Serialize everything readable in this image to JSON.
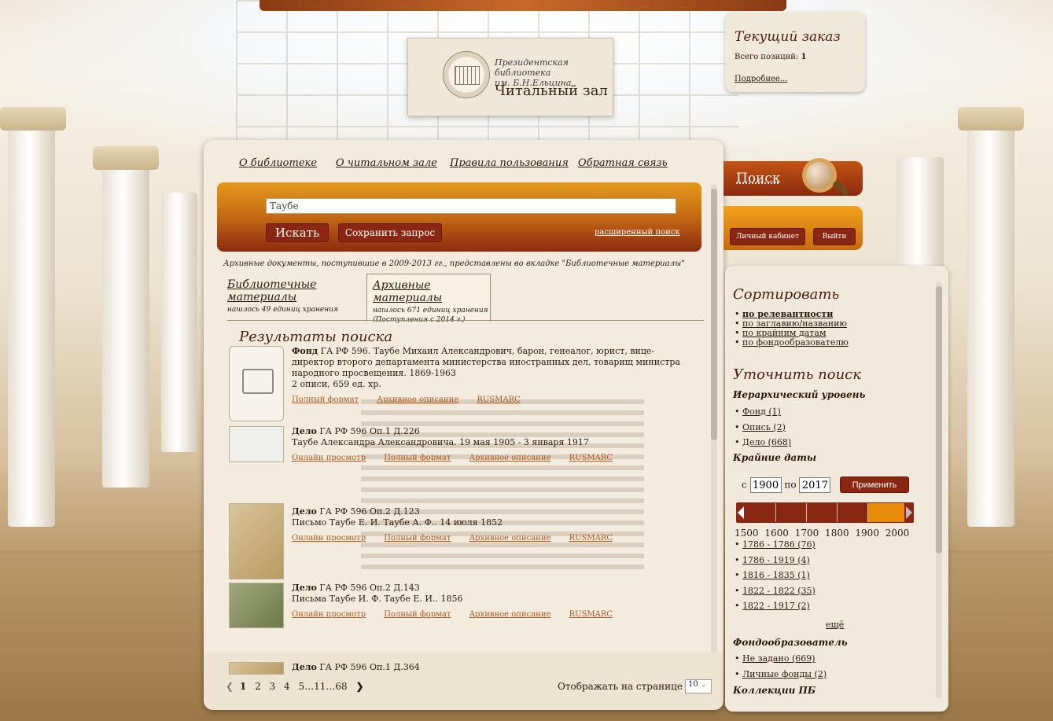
{
  "header": {
    "library_name_line1": "Президентская библиотека",
    "library_name_line2": "им. Б.Н.Ельцина",
    "reading_room": "Читальный зал"
  },
  "order": {
    "title": "Текущий заказ",
    "count_label": "Всего позиций:",
    "count_value": "1",
    "more_link": "Подробнее..."
  },
  "nav": {
    "items": [
      "О библиотеке",
      "О читальном зале",
      "Правила пользования",
      "Обратная связь"
    ]
  },
  "search": {
    "query": "Таубе",
    "submit_label": "Искать",
    "save_label": "Сохранить запрос",
    "advanced_link": "расширенный поиск"
  },
  "notice": "Архивные документы, поступившие в 2009-2013 гг., представлены во вкладке \"Библиотечные материалы\"",
  "tabs": [
    {
      "label": "Библиотечные материалы",
      "sub": "нашлось 49 единиц хранения",
      "sub2": ""
    },
    {
      "label": "Архивные материалы",
      "sub": "нашлось 671 единиц хранения",
      "sub2": "(Поступления с 2014 г.)"
    }
  ],
  "results": {
    "title": "Результаты поиска",
    "items": [
      {
        "kind": "Фонд",
        "text": "ГА РФ 596. Таубе Михаил Александрович, барон, генеалог, юрист, вице-директор второго департамента министерства иностранных дел, товарищ министра народного просвещения. 1869-1963",
        "extra": "2 описи, 659 ед. хр.",
        "links": [
          "Полный формат",
          "Архивное описание",
          "RUSMARC"
        ]
      },
      {
        "kind": "Дело",
        "text": "ГА РФ 596 Оп.1 Д.226",
        "extra": "Таубе Александра Александровича. 19 мая 1905 - 3 января 1917",
        "links": [
          "Онлайн просмотр",
          "Полный формат",
          "Архивное описание",
          "RUSMARC"
        ]
      },
      {
        "kind": "Дело",
        "text": "ГА РФ 596 Оп.2 Д.123",
        "extra": "Письмо Таубе Е. И. Таубе А. Ф.. 14 июля 1852",
        "links": [
          "Онлайн просмотр",
          "Полный формат",
          "Архивное описание",
          "RUSMARC"
        ]
      },
      {
        "kind": "Дело",
        "text": "ГА РФ 596 Оп.2 Д.143",
        "extra": "Письма Таубе И. Ф. Таубе Е. И.. 1856",
        "links": [
          "Онлайн просмотр",
          "Полный формат",
          "Архивное описание",
          "RUSMARC"
        ]
      },
      {
        "kind": "Дело",
        "text": "ГА РФ 596 Оп.1 Д.364",
        "extra": "",
        "links": []
      }
    ]
  },
  "pager": {
    "pages": [
      "1",
      "2",
      "3",
      "4",
      "5…11…68"
    ],
    "per_page_label": "Отображать на странице",
    "per_page_value": "10"
  },
  "side_search": {
    "tab_label": "Поиск",
    "cabinet_label": "Личный кабинет",
    "exit_label": "Выйти"
  },
  "sidebar": {
    "sort_title": "Сортировать",
    "sort_options": [
      "по релевантности",
      "по заглавию/названию",
      "по крайним датам",
      "по фондообразователю"
    ],
    "refine_title": "Уточнить поиск",
    "hierarchy_title": "Иерархический уровень",
    "hierarchy": [
      "Фонд (1)",
      "Опись (2)",
      "Дело (668)"
    ],
    "dates_title": "Крайние даты",
    "date_from_label": "с",
    "date_from": "1900",
    "date_to_label": "по",
    "date_to": "2017",
    "apply_label": "Применить",
    "scale": "1500 1600 1700 1800 1900 2000",
    "date_ranges": [
      "1786 - 1786 (76)",
      "1786 - 1919 (4)",
      "1816 - 1835 (1)",
      "1822 - 1822 (35)",
      "1822 - 1917 (2)"
    ],
    "more_label": "ещё",
    "creator_title": "Фондообразователь",
    "creators": [
      "Не задано (669)",
      "Личные фонды (2)"
    ],
    "collections_title": "Коллекции ПБ"
  }
}
